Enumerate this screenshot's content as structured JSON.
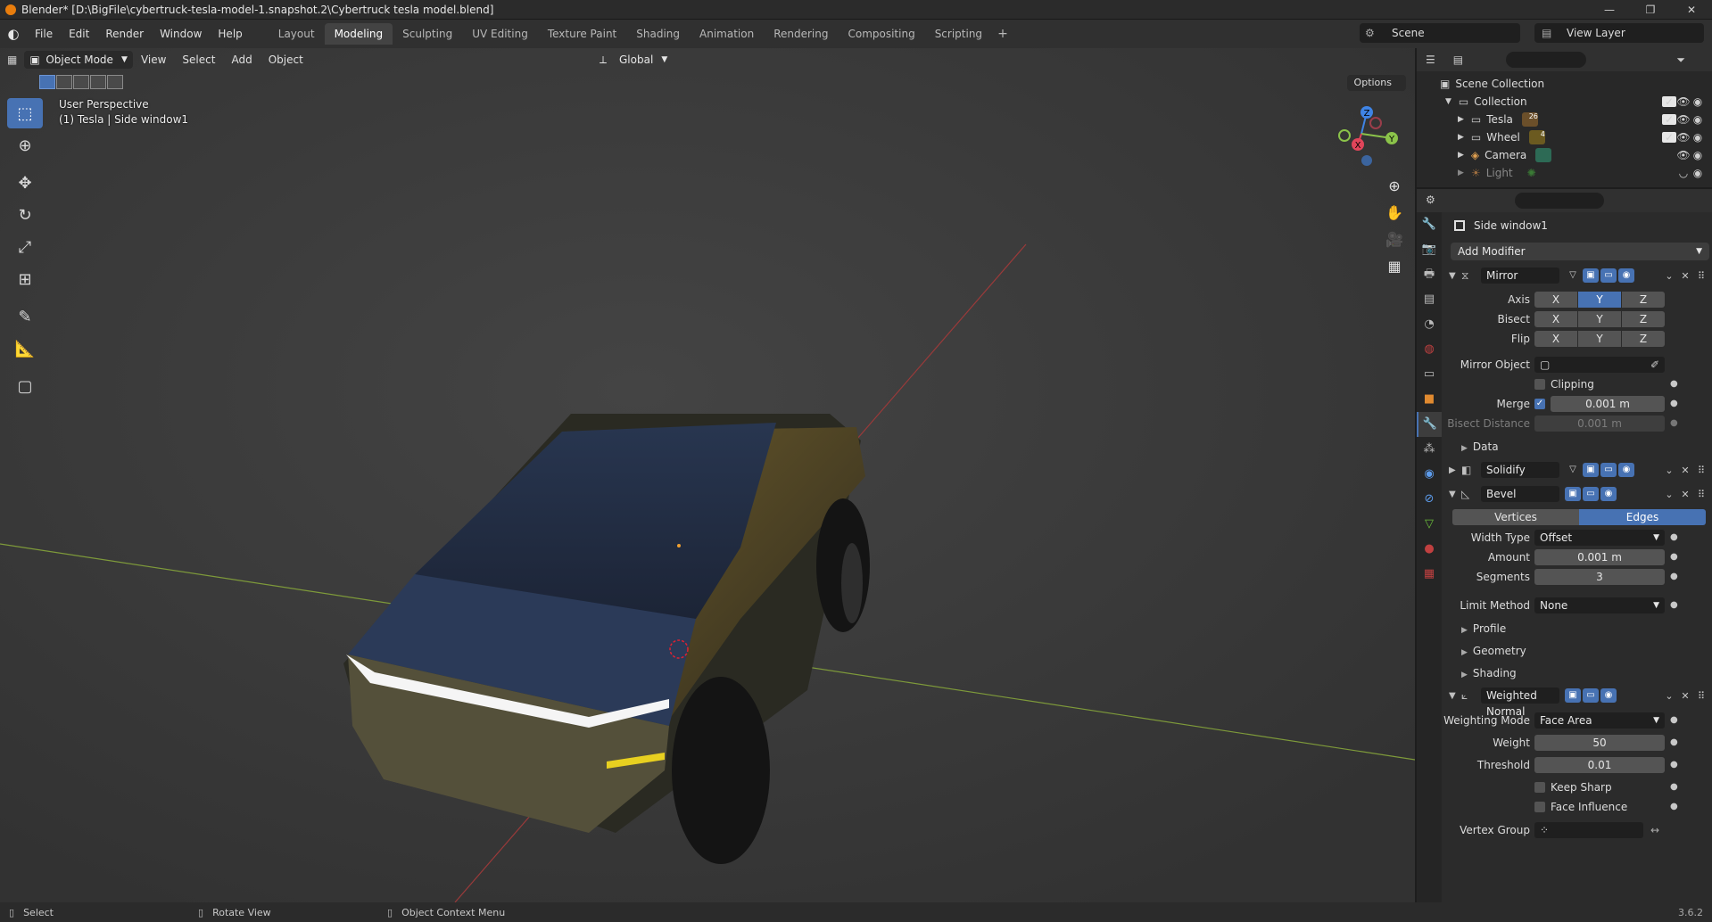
{
  "window": {
    "title": "Blender* [D:\\BigFile\\cybertruck-tesla-model-1.snapshot.2\\Cybertruck tesla model.blend]",
    "minimize": "—",
    "maximize": "❐",
    "close": "✕"
  },
  "menubar": {
    "items": [
      "File",
      "Edit",
      "Render",
      "Window",
      "Help"
    ],
    "workspaces": [
      "Layout",
      "Modeling",
      "Sculpting",
      "UV Editing",
      "Texture Paint",
      "Shading",
      "Animation",
      "Rendering",
      "Compositing",
      "Scripting"
    ],
    "active_workspace": "Modeling",
    "add_tab": "+",
    "scene": "Scene",
    "view_layer": "View Layer"
  },
  "viewport": {
    "mode": "Object Mode",
    "menus": [
      "View",
      "Select",
      "Add",
      "Object"
    ],
    "transform_orientation": "Global",
    "options": "Options",
    "view_name": "User Perspective",
    "object_info": "(1) Tesla | Side window1",
    "gizmo": {
      "x": "X",
      "y": "Y",
      "z": "Z"
    }
  },
  "outliner": {
    "root": "Scene Collection",
    "collection": "Collection",
    "items": [
      {
        "label": "Tesla",
        "badge": "26",
        "badge_color": "#6b4f2a",
        "dim": false
      },
      {
        "label": "Wheel",
        "badge": "4",
        "badge_color": "#6b5a20",
        "dim": false
      },
      {
        "label": "Camera",
        "badge": "",
        "badge_color": "#2d6a55",
        "dim": false
      },
      {
        "label": "Light",
        "badge": "",
        "badge_color": "#3a5a35",
        "dim": true
      }
    ]
  },
  "properties": {
    "object_name": "Side window1",
    "add_modifier": "Add Modifier",
    "mirror": {
      "name": "Mirror",
      "axis_label": "Axis",
      "bisect_label": "Bisect",
      "flip_label": "Flip",
      "xyz": [
        "X",
        "Y",
        "Z"
      ],
      "mirror_object_label": "Mirror Object",
      "clipping_label": "Clipping",
      "merge_label": "Merge",
      "merge_value": "0.001 m",
      "bisect_distance_label": "Bisect Distance",
      "bisect_distance_value": "0.001 m",
      "data_label": "Data"
    },
    "solidify": {
      "name": "Solidify"
    },
    "bevel": {
      "name": "Bevel",
      "vertices": "Vertices",
      "edges": "Edges",
      "width_type_label": "Width Type",
      "width_type_value": "Offset",
      "amount_label": "Amount",
      "amount_value": "0.001 m",
      "segments_label": "Segments",
      "segments_value": "3",
      "limit_method_label": "Limit Method",
      "limit_method_value": "None",
      "profile_label": "Profile",
      "geometry_label": "Geometry",
      "shading_label": "Shading"
    },
    "weighted_normal": {
      "name": "Weighted Normal",
      "weighting_mode_label": "Weighting Mode",
      "weighting_mode_value": "Face Area",
      "weight_label": "Weight",
      "weight_value": "50",
      "threshold_label": "Threshold",
      "threshold_value": "0.01",
      "keep_sharp_label": "Keep Sharp",
      "face_influence_label": "Face Influence",
      "vertex_group_label": "Vertex Group"
    }
  },
  "statusbar": {
    "select": "Select",
    "rotate_view": "Rotate View",
    "context_menu": "Object Context Menu",
    "version": "3.6.2"
  },
  "colors": {
    "accent": "#4772b3",
    "x_axis": "#e0455a",
    "y_axis": "#8bc34a",
    "z_axis": "#3f84e5"
  }
}
